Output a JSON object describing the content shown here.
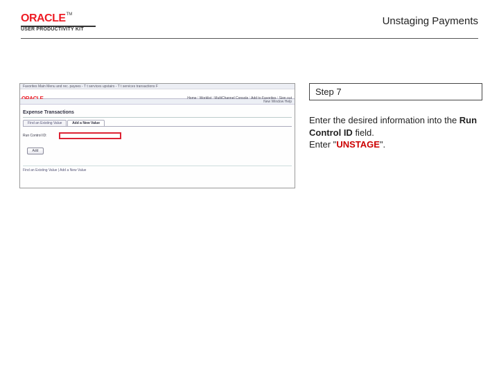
{
  "brand": {
    "oracle": "ORACLE",
    "tm": "TM",
    "sub": "USER PRODUCTIVITY KIT"
  },
  "doc": {
    "title": "Unstaging Payments"
  },
  "step": {
    "label": "Step 7"
  },
  "instruction": {
    "line1_a": "Enter the desired information into the ",
    "field": "Run Control ID",
    "line1_b": " field.",
    "line2_a": "Enter \"",
    "value": "UNSTAGE",
    "line2_b": "\"."
  },
  "scr": {
    "breadcrumb": "Favorites   Main Menu   and rec.   payees - T   t services   upstairs - T   t services transactions   F",
    "nav": {
      "home": "Home",
      "worklist": "Worklist",
      "multichannel": "MultiChannel Console",
      "addto": "Add to Favorites",
      "signout": "Sign out"
    },
    "substatus": "New Window   Help",
    "section": "Expense Transactions",
    "tabs": {
      "find": "Find an Existing Value",
      "add": "Add a New Value"
    },
    "input_label": "Run Control ID:",
    "add_btn": "Add",
    "footer": "Find an Existing Value | Add a New Value"
  }
}
